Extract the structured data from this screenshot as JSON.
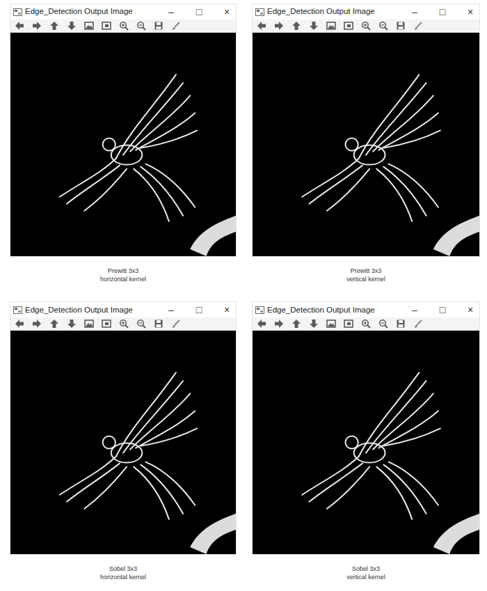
{
  "windows": [
    {
      "title": "Edge_Detection Output Image",
      "controls": [
        "–",
        "□",
        "×"
      ],
      "caption": [
        "Prewitt 3x3",
        "horizontal kernel"
      ]
    },
    {
      "title": "Edge_Detection Output Image",
      "controls": [
        "–",
        "□",
        "×"
      ],
      "caption": [
        "Prewitt 3x3",
        "vertical kernel"
      ]
    },
    {
      "title": "Edge_Detection Output Image",
      "controls": [
        "–",
        "□",
        "×"
      ],
      "caption": [
        "Sobel 3x3",
        "horizontal kernel"
      ]
    },
    {
      "title": "Edge_Detection Output Image",
      "controls": [
        "–",
        "□",
        "×"
      ],
      "caption": [
        "Sobel 3x3",
        "vertical kernel"
      ]
    }
  ]
}
